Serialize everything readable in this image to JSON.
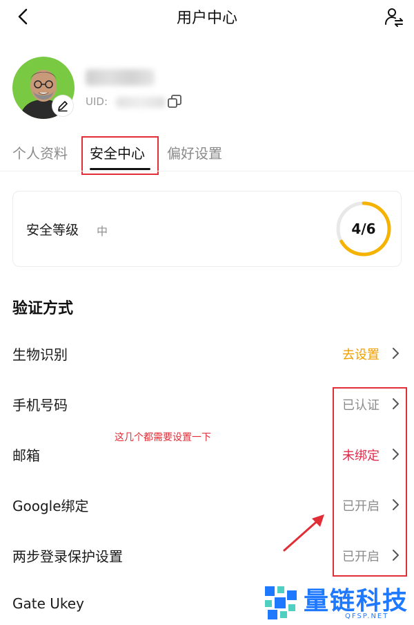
{
  "header": {
    "title": "用户中心",
    "back_icon": "chevron-left-icon",
    "action_icon": "user-switch-icon"
  },
  "profile": {
    "uid_label": "UID:",
    "edit_icon": "pencil-icon",
    "copy_icon": "copy-icon",
    "avatar_bg": "#7ac943"
  },
  "tabs": [
    {
      "label": "个人资料",
      "active": false
    },
    {
      "label": "安全中心",
      "active": true
    },
    {
      "label": "偏好设置",
      "active": false
    }
  ],
  "security": {
    "label": "安全等级",
    "level": "中",
    "score_text": "4/6",
    "score_fraction": 0.667,
    "ring_color": "#f5b300",
    "ring_track": "#e8e8e8"
  },
  "section_title": "验证方式",
  "items": [
    {
      "label": "生物识别",
      "status": "去设置",
      "status_color": "#f0a000"
    },
    {
      "label": "手机号码",
      "status": "已认证",
      "status_color": "#8a8a8a"
    },
    {
      "label": "邮箱",
      "status": "未绑定",
      "status_color": "#e0294a"
    },
    {
      "label": "Google绑定",
      "status": "已开启",
      "status_color": "#8a8a8a"
    },
    {
      "label": "两步登录保护设置",
      "status": "已开启",
      "status_color": "#8a8a8a"
    },
    {
      "label": "Gate Ukey",
      "status": "",
      "status_color": "#8a8a8a"
    }
  ],
  "annotation": {
    "note": "这几个都需要设置一下",
    "color": "#e02d36"
  },
  "watermark": {
    "text": "量链科技",
    "sub": "QFSP.NET",
    "color": "#1f79ff"
  }
}
